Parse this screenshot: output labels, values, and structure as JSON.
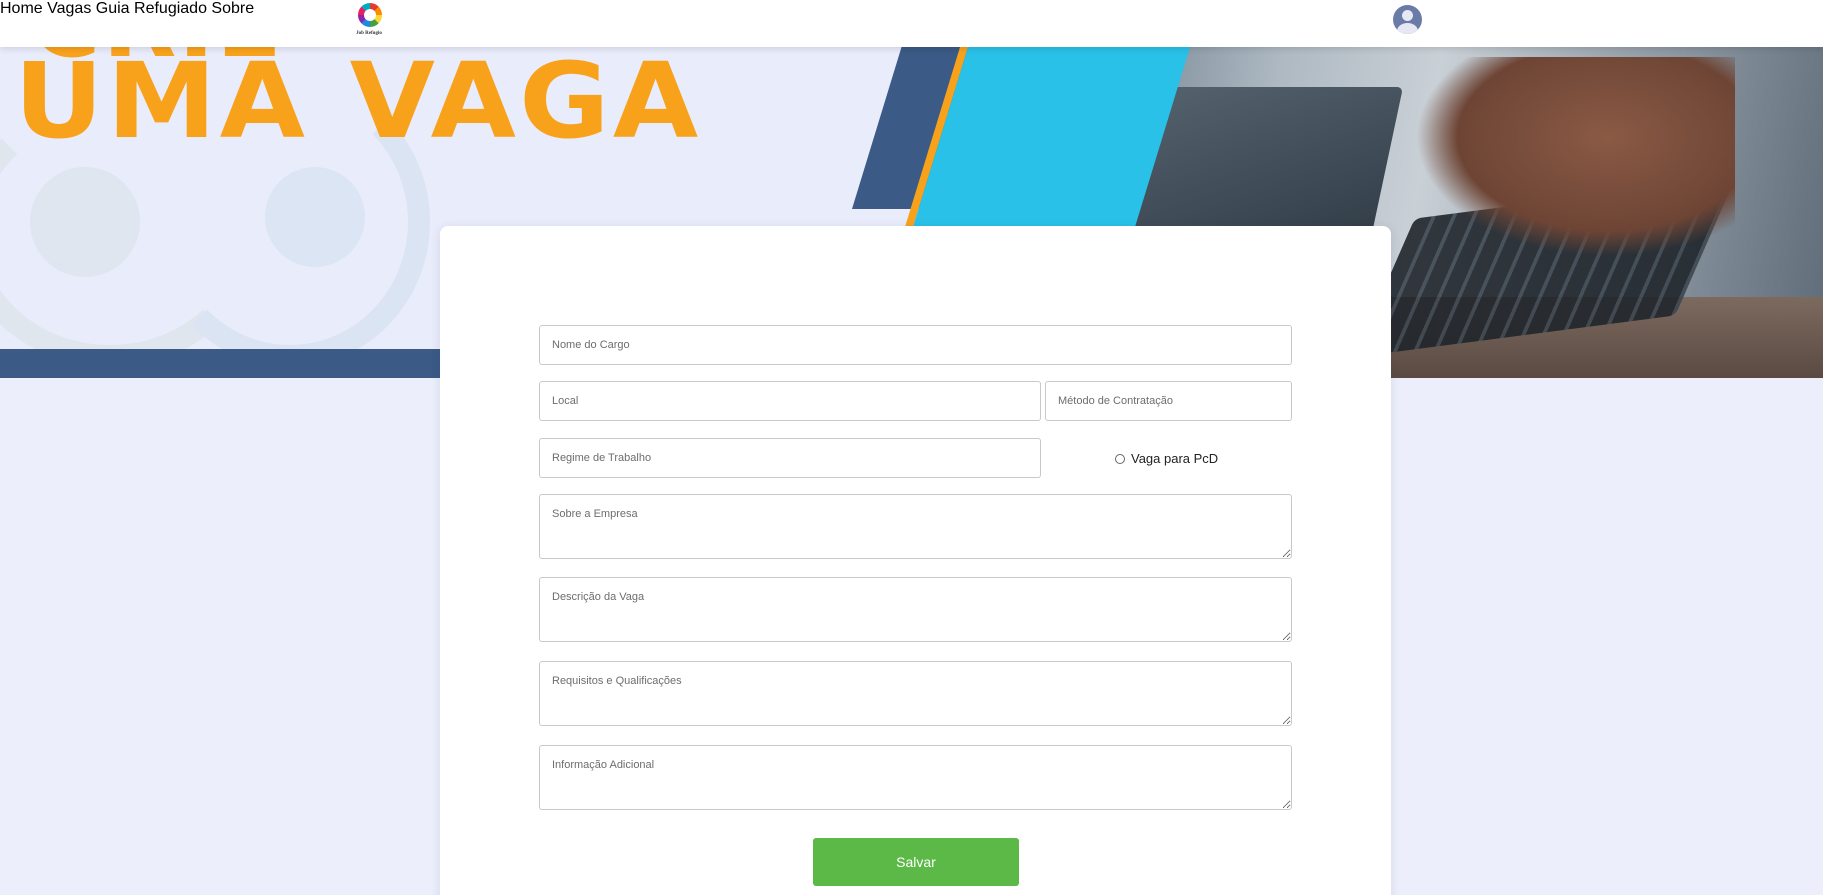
{
  "header": {
    "logo_text": "Job Refugio",
    "nav": [
      {
        "label": "Home"
      },
      {
        "label": "Vagas"
      },
      {
        "label": "Guia Refugiado"
      },
      {
        "label": "Sobre"
      }
    ]
  },
  "hero": {
    "title_top": "CRIE",
    "title": "UMA VAGA"
  },
  "form": {
    "nome_cargo": {
      "placeholder": "Nome do Cargo"
    },
    "local": {
      "placeholder": "Local"
    },
    "metodo": {
      "placeholder": "Método de Contratação"
    },
    "regime": {
      "placeholder": "Regime de Trabalho"
    },
    "pcd_label": "Vaga para PcD",
    "sobre_empresa": {
      "placeholder": "Sobre a Empresa"
    },
    "descricao": {
      "placeholder": "Descrição da Vaga"
    },
    "requisitos": {
      "placeholder": "Requisitos e Qualificações"
    },
    "info_adicional": {
      "placeholder": "Informação Adicional"
    },
    "save_label": "Salvar"
  },
  "colors": {
    "accent_orange": "#f8a21c",
    "navy": "#3b5a86",
    "cyan": "#29c1e8",
    "save_green": "#5cb948"
  }
}
